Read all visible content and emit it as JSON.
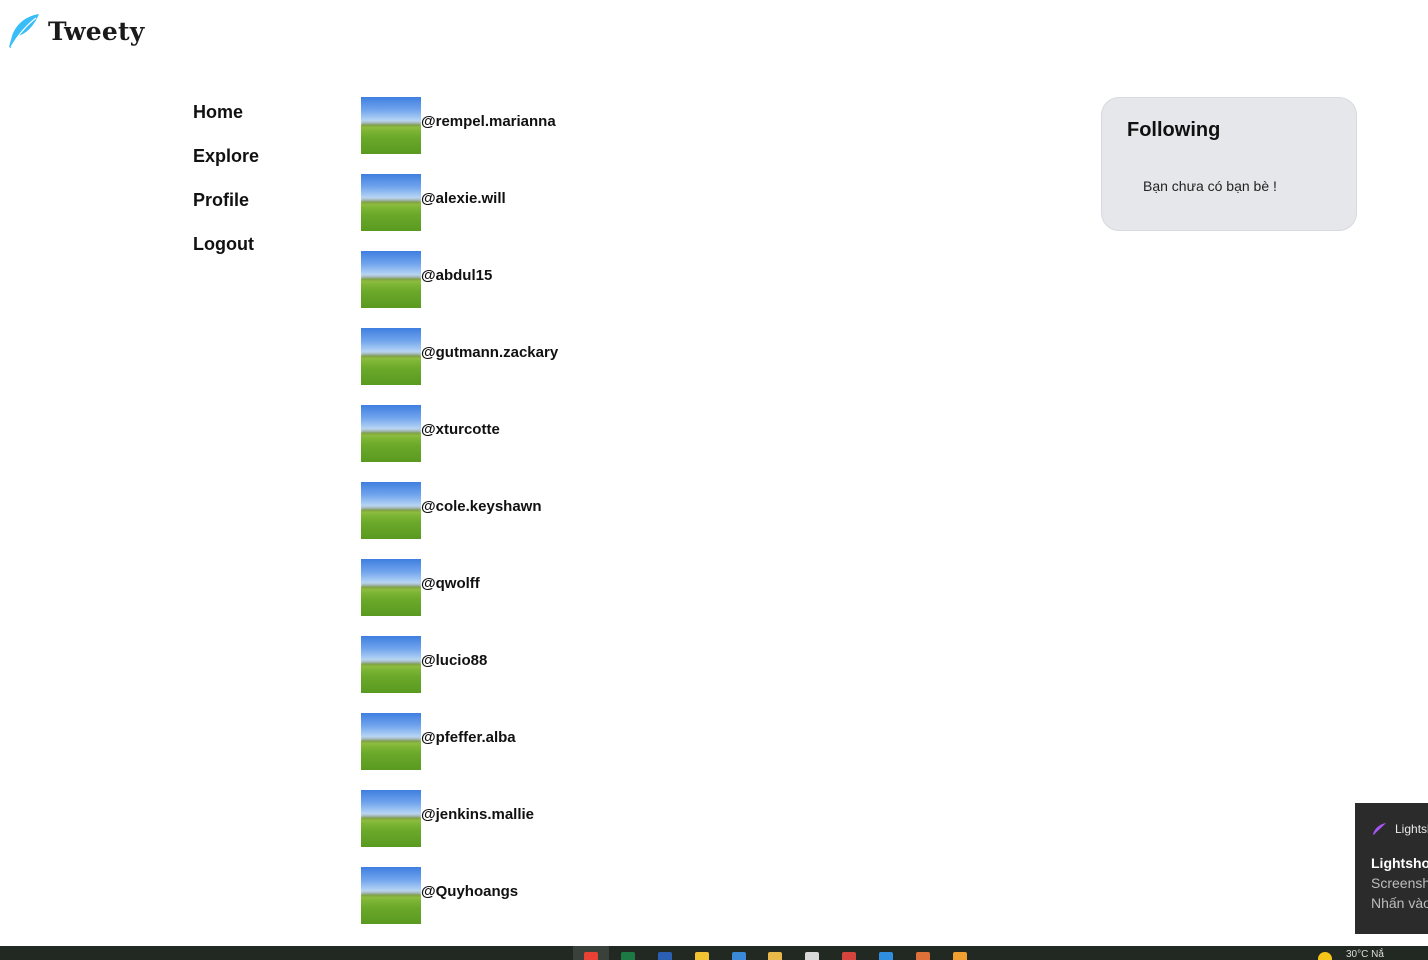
{
  "app": {
    "name": "Tweety",
    "accent_color": "#38bdf8"
  },
  "nav": {
    "items": [
      {
        "label": "Home"
      },
      {
        "label": "Explore"
      },
      {
        "label": "Profile"
      },
      {
        "label": "Logout"
      }
    ]
  },
  "users": [
    {
      "handle": "@rempel.marianna"
    },
    {
      "handle": "@alexie.will"
    },
    {
      "handle": "@abdul15"
    },
    {
      "handle": "@gutmann.zackary"
    },
    {
      "handle": "@xturcotte"
    },
    {
      "handle": "@cole.keyshawn"
    },
    {
      "handle": "@qwolff"
    },
    {
      "handle": "@lucio88"
    },
    {
      "handle": "@pfeffer.alba"
    },
    {
      "handle": "@jenkins.mallie"
    },
    {
      "handle": "@Quyhoangs"
    }
  ],
  "following": {
    "title": "Following",
    "empty_text": "Bạn chưa có bạn bè !"
  },
  "toast": {
    "app_name": "Lightshot",
    "title": "Lightshot",
    "line1": "Screenshot",
    "line2": "Nhấn vào"
  },
  "taskbar": {
    "tray_text": "30°C  Nắ"
  }
}
